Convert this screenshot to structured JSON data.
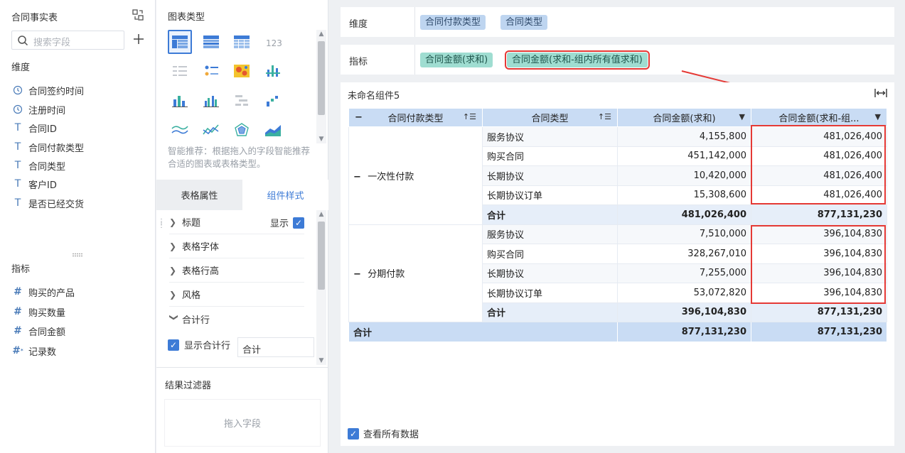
{
  "left_panel": {
    "dataset_title": "合同事实表",
    "search_placeholder": "搜索字段",
    "dimension_label": "维度",
    "dimensions": [
      {
        "label": "合同签约时间",
        "icon": "clock-icon"
      },
      {
        "label": "注册时间",
        "icon": "clock-icon"
      },
      {
        "label": "合同ID",
        "icon": "text-icon"
      },
      {
        "label": "合同付款类型",
        "icon": "text-icon"
      },
      {
        "label": "合同类型",
        "icon": "text-icon"
      },
      {
        "label": "客户ID",
        "icon": "text-icon"
      },
      {
        "label": "是否已经交货",
        "icon": "text-icon"
      }
    ],
    "measure_label": "指标",
    "measures": [
      {
        "label": "购买的产品",
        "icon": "hash-icon"
      },
      {
        "label": "购买数量",
        "icon": "hash-icon"
      },
      {
        "label": "合同金额",
        "icon": "hash-icon"
      },
      {
        "label": "记录数",
        "icon": "hash-star-icon"
      }
    ]
  },
  "config_panel": {
    "chart_type_title": "图表类型",
    "recommend_text": "智能推荐：根据拖入的字段智能推荐合适的图表或表格类型。",
    "tabs": [
      "表格属性",
      "组件样式"
    ],
    "active_tab": "组件样式",
    "style_items": [
      {
        "label": "标题",
        "expanded": false
      },
      {
        "label": "表格字体",
        "expanded": false
      },
      {
        "label": "表格行高",
        "expanded": false
      },
      {
        "label": "风格",
        "expanded": false
      },
      {
        "label": "合计行",
        "expanded": true
      }
    ],
    "show_label": "显示",
    "show_total_label": "显示合计行",
    "total_name_value": "合计",
    "result_filter_title": "结果过滤器",
    "drop_hint": "拖入字段"
  },
  "shelves": {
    "dimension_label": "维度",
    "dimension_pills": [
      "合同付款类型",
      "合同类型"
    ],
    "measure_label": "指标",
    "measure_pills": [
      "合同金额(求和)",
      "合同金额(求和-组内所有值求和)"
    ]
  },
  "widget": {
    "title": "未命名组件5",
    "columns": [
      "合同付款类型",
      "合同类型",
      "合同金额(求和)",
      "合同金额(求和-组..."
    ],
    "groups": [
      {
        "name": "一次性付款",
        "rows": [
          {
            "type": "服务协议",
            "sum": "4,155,800",
            "group_sum": "481,026,400"
          },
          {
            "type": "购买合同",
            "sum": "451,142,000",
            "group_sum": "481,026,400"
          },
          {
            "type": "长期协议",
            "sum": "10,420,000",
            "group_sum": "481,026,400"
          },
          {
            "type": "长期协议订单",
            "sum": "15,308,600",
            "group_sum": "481,026,400"
          }
        ],
        "subtotal_label": "合计",
        "subtotal_sum": "481,026,400",
        "subtotal_group_sum": "877,131,230"
      },
      {
        "name": "分期付款",
        "rows": [
          {
            "type": "服务协议",
            "sum": "7,510,000",
            "group_sum": "396,104,830"
          },
          {
            "type": "购买合同",
            "sum": "328,267,010",
            "group_sum": "396,104,830"
          },
          {
            "type": "长期协议",
            "sum": "7,255,000",
            "group_sum": "396,104,830"
          },
          {
            "type": "长期协议订单",
            "sum": "53,072,820",
            "group_sum": "396,104,830"
          }
        ],
        "subtotal_label": "合计",
        "subtotal_sum": "396,104,830",
        "subtotal_group_sum": "877,131,230"
      }
    ],
    "grand_total_label": "合计",
    "grand_total_sum": "877,131,230",
    "grand_total_group_sum": "877,131,230",
    "view_all_label": "查看所有数据"
  },
  "colors": {
    "accent": "#3d7bd6",
    "highlight_red": "#e53935",
    "dimension_pill": "#bed5f0",
    "measure_pill": "#9fddd1",
    "header_bg": "#c9dcf4"
  }
}
